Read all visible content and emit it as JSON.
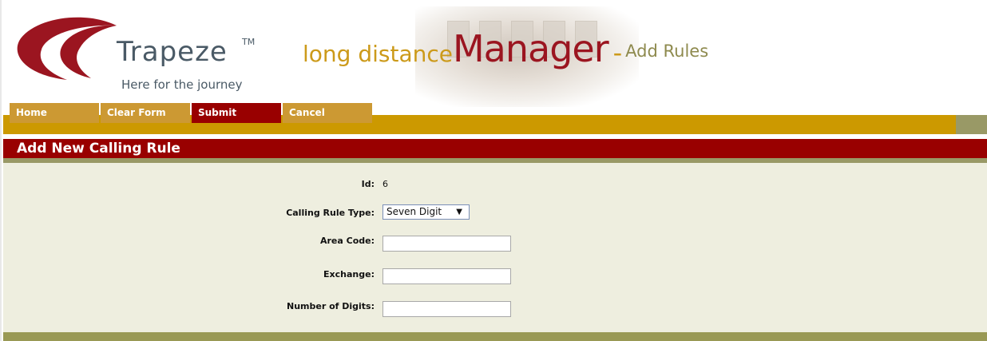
{
  "header": {
    "brand_name": "Trapeze",
    "brand_tm": "TM",
    "brand_tagline": "Here for the journey",
    "app_title_part1": "long distance",
    "app_title_part2": "Manager",
    "app_title_dash": "-",
    "page_title": "Add Rules"
  },
  "toolbar": {
    "home_label": "Home",
    "clear_label": "Clear Form",
    "submit_label": "Submit",
    "cancel_label": "Cancel"
  },
  "section": {
    "heading": "Add New Calling Rule"
  },
  "form": {
    "id_label": "Id:",
    "id_value": "6",
    "rule_type_label": "Calling Rule Type:",
    "rule_type_value": "Seven Digit",
    "area_code_label": "Area Code:",
    "area_code_value": "",
    "exchange_label": "Exchange:",
    "exchange_value": "",
    "num_digits_label": "Number of Digits:",
    "num_digits_value": ""
  },
  "colors": {
    "brand_red": "#990000",
    "brand_gold": "#cc9900",
    "olive": "#999966",
    "form_bg": "#eeeedf"
  },
  "icons": {
    "logo": "trapeze-swoosh-logo",
    "dropdown": "triangle-down-icon"
  }
}
